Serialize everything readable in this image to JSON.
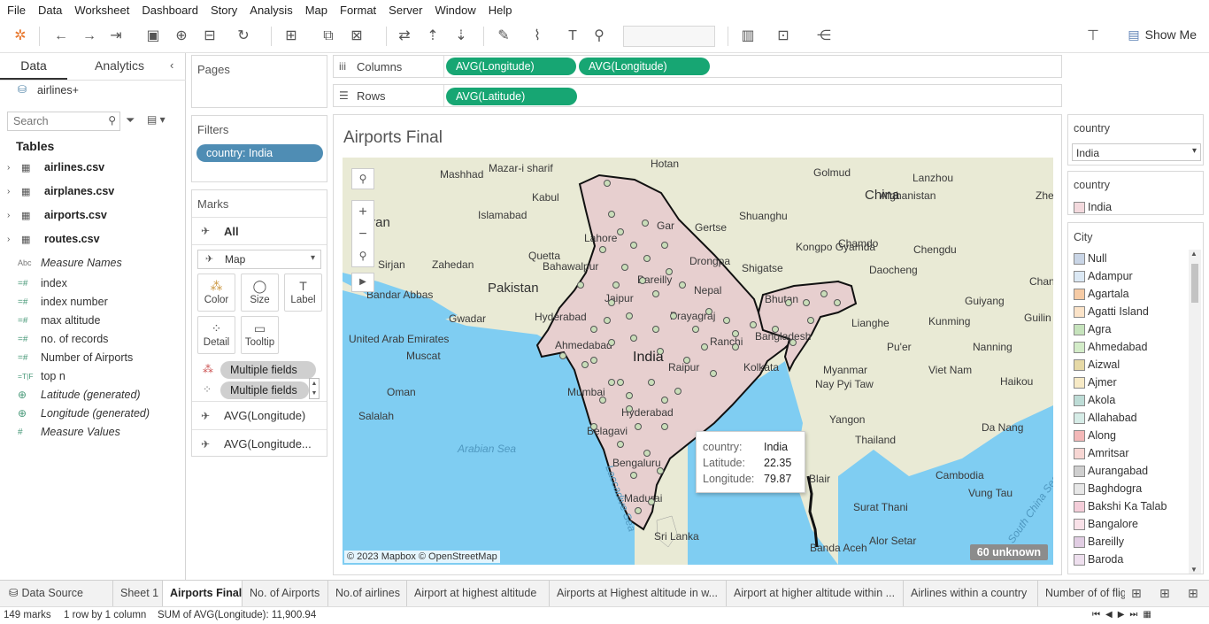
{
  "menu": [
    "File",
    "Data",
    "Worksheet",
    "Dashboard",
    "Story",
    "Analysis",
    "Map",
    "Format",
    "Server",
    "Window",
    "Help"
  ],
  "toolbar": {
    "show_me": "Show Me"
  },
  "left_pane": {
    "tab_data": "Data",
    "tab_analytics": "Analytics",
    "datasource": "airlines+",
    "search_placeholder": "Search",
    "tables_header": "Tables",
    "tables": [
      "airlines.csv",
      "airplanes.csv",
      "airports.csv",
      "routes.csv"
    ],
    "measure_names": "Measure Names",
    "fields": [
      {
        "name": "index",
        "icon": "=#"
      },
      {
        "name": "index number",
        "icon": "=#"
      },
      {
        "name": "max altitude",
        "icon": "=#"
      },
      {
        "name": "no. of records",
        "icon": "=#"
      },
      {
        "name": "Number of Airports",
        "icon": "=#"
      },
      {
        "name": "top n",
        "icon": "=T|F"
      },
      {
        "name": "Latitude (generated)",
        "icon": "globe"
      },
      {
        "name": "Longitude (generated)",
        "icon": "globe"
      },
      {
        "name": "Measure Values",
        "icon": "#"
      }
    ]
  },
  "pages": {
    "title": "Pages"
  },
  "filters": {
    "title": "Filters",
    "pill": "country: India"
  },
  "marks": {
    "title": "Marks",
    "all": "All",
    "type": "Map",
    "buttons": [
      "Color",
      "Size",
      "Label",
      "Detail",
      "Tooltip"
    ],
    "field_pills": [
      "Multiple fields",
      "Multiple fields"
    ],
    "layers": [
      "AVG(Longitude)",
      "AVG(Longitude..."
    ]
  },
  "shelves": {
    "columns_label": "Columns",
    "columns": [
      "AVG(Longitude)",
      "AVG(Longitude)"
    ],
    "rows_label": "Rows",
    "rows": [
      "AVG(Latitude)"
    ]
  },
  "viz": {
    "title": "Airports Final",
    "attribution": "© 2023 Mapbox © OpenStreetMap",
    "unknown": "60 unknown",
    "tooltip": {
      "country_key": "country:",
      "country_val": "India",
      "lat_key": "Latitude:",
      "lat_val": "22.35",
      "lon_key": "Longitude:",
      "lon_val": "79.87"
    },
    "map_labels": [
      "Hotan",
      "Golmud",
      "Lanzhou",
      "Mashhad",
      "Mazar-i sharif",
      "Kabul",
      "Islamabad",
      "Afghanistan",
      "Zhengzh",
      "China",
      "Shuanghu",
      "Gertse",
      "Gar",
      "Lahore",
      "Iran",
      "Quetta",
      "Bahawalpur",
      "Kongpo Gyamda",
      "Chamdo",
      "Chengdu",
      "Sirjan",
      "Zahedan",
      "Drongpa",
      "Shigatse",
      "Daocheng",
      "Changsh",
      "Bareilly",
      "Pakistan",
      "Nepal",
      "Bandar Abbas",
      "Bhutan",
      "Guiyang",
      "Jaipur",
      "Hyderabad",
      "Gwadar",
      "Prayagraj",
      "Ranchi",
      "Kunming",
      "Guilin",
      "United Arab Emirates",
      "Muscat",
      "Bangladesh",
      "Lianghe",
      "Pu'er",
      "Nanning",
      "Ahmedabad",
      "India",
      "Myanmar",
      "Viet Nam",
      "Oman",
      "Raipur",
      "Kolkata",
      "Nay Pyi Taw",
      "Haikou",
      "Mumbai",
      "Salalah",
      "Hyderabad",
      "Yangon",
      "Da Nang",
      "Belagavi",
      "Arabian Sea",
      "Thailand",
      "Bengaluru",
      "Cambodia",
      "Vung Tau",
      "Madurai",
      "Surat Thani",
      "Sri Lanka",
      "Alor Setar",
      "Banda Aceh",
      "Blair",
      "Laccadive Sea",
      "South China Sea"
    ]
  },
  "legends": {
    "country_filter_title": "country",
    "country_filter_value": "India",
    "country_color_title": "country",
    "country_color_items": [
      {
        "name": "India",
        "color": "#f3d9dd"
      }
    ],
    "city_title": "City",
    "city_items": [
      {
        "name": "Null",
        "color": "#c9d5e6"
      },
      {
        "name": "Adampur",
        "color": "#dbe8f4"
      },
      {
        "name": "Agartala",
        "color": "#f6cba5"
      },
      {
        "name": "Agatti Island",
        "color": "#fbe3c8"
      },
      {
        "name": "Agra",
        "color": "#c6e3bc"
      },
      {
        "name": "Ahmedabad",
        "color": "#d3ecc8"
      },
      {
        "name": "Aizwal",
        "color": "#e6d9a6"
      },
      {
        "name": "Ajmer",
        "color": "#f7eac6"
      },
      {
        "name": "Akola",
        "color": "#bddcd6"
      },
      {
        "name": "Allahabad",
        "color": "#d6ece7"
      },
      {
        "name": "Along",
        "color": "#f3b8b8"
      },
      {
        "name": "Amritsar",
        "color": "#f7d6d3"
      },
      {
        "name": "Aurangabad",
        "color": "#cfcfcf"
      },
      {
        "name": "Baghdogra",
        "color": "#e7e7e7"
      },
      {
        "name": "Bakshi Ka Talab",
        "color": "#f4cdd9"
      },
      {
        "name": "Bangalore",
        "color": "#f9e1e8"
      },
      {
        "name": "Bareilly",
        "color": "#e1cde3"
      },
      {
        "name": "Baroda",
        "color": "#eedfee"
      }
    ]
  },
  "sheet_tabs": [
    "Data Source",
    "Sheet 1",
    "Airports Final",
    "No. of Airports",
    "No.of airlines",
    "Airport at highest altitude",
    "Airports at Highest altitude in w...",
    "Airport at higher altitude within ...",
    "Airlines within a country",
    "Number of of flig"
  ],
  "status": {
    "marks": "149 marks",
    "rows": "1 row by 1 column",
    "sum": "SUM of AVG(Longitude): 11,900.94"
  }
}
